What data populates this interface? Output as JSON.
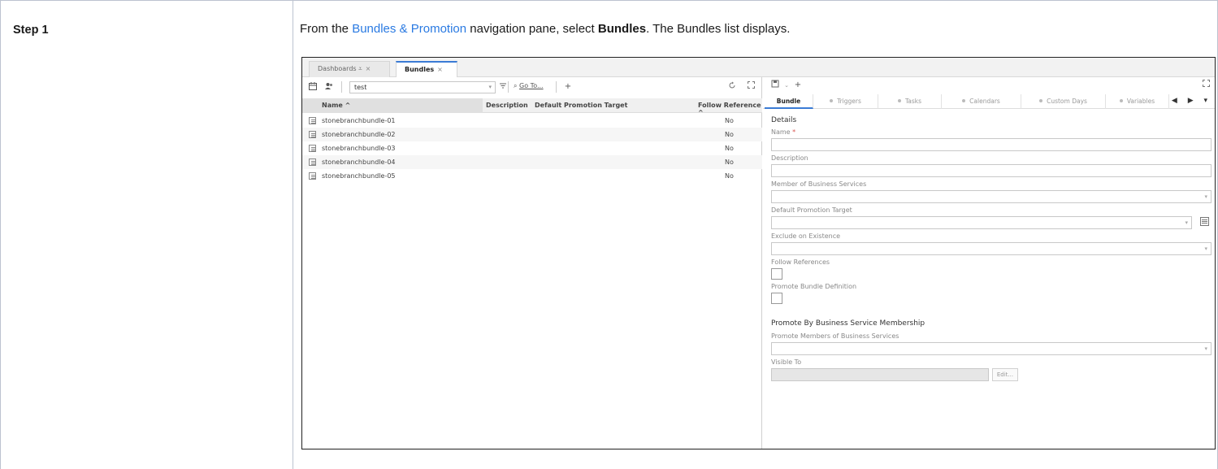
{
  "doc": {
    "step_label": "Step 1",
    "instruction": {
      "prefix": "From the ",
      "link": "Bundles & Promotion",
      "middle": " navigation pane, select ",
      "bold": "Bundles",
      "suffix": ". The Bundles list displays."
    }
  },
  "app": {
    "tabs": [
      {
        "label": "Dashboards ⩡",
        "close": "×"
      },
      {
        "label": "Bundles",
        "close": "×"
      }
    ],
    "toolbar": {
      "search_value": "test",
      "goto_label": "Go To...",
      "add": "+"
    },
    "list": {
      "columns": [
        "Name ^",
        "Description",
        "Default Promotion Target",
        "Follow Reference ^"
      ],
      "rows": [
        {
          "name": "stonebranchbundle-01",
          "follow": "No"
        },
        {
          "name": "stonebranchbundle-02",
          "follow": "No"
        },
        {
          "name": "stonebranchbundle-03",
          "follow": "No"
        },
        {
          "name": "stonebranchbundle-04",
          "follow": "No"
        },
        {
          "name": "stonebranchbundle-05",
          "follow": "No"
        }
      ]
    },
    "detail": {
      "tabs": [
        "Bundle",
        "Triggers",
        "Tasks",
        "Calendars",
        "Custom Days",
        "Variables"
      ],
      "section_details": "Details",
      "name_label": "Name",
      "required_mark": "*",
      "description_label": "Description",
      "member_label": "Member of Business Services",
      "default_target_label": "Default Promotion Target",
      "exclude_label": "Exclude on Existence",
      "follow_refs_label": "Follow References",
      "promote_def_label": "Promote Bundle Definition",
      "section_promote": "Promote By Business Service Membership",
      "promote_members_label": "Promote Members of Business Services",
      "visible_to_label": "Visible To",
      "edit_button": "Edit..."
    }
  }
}
